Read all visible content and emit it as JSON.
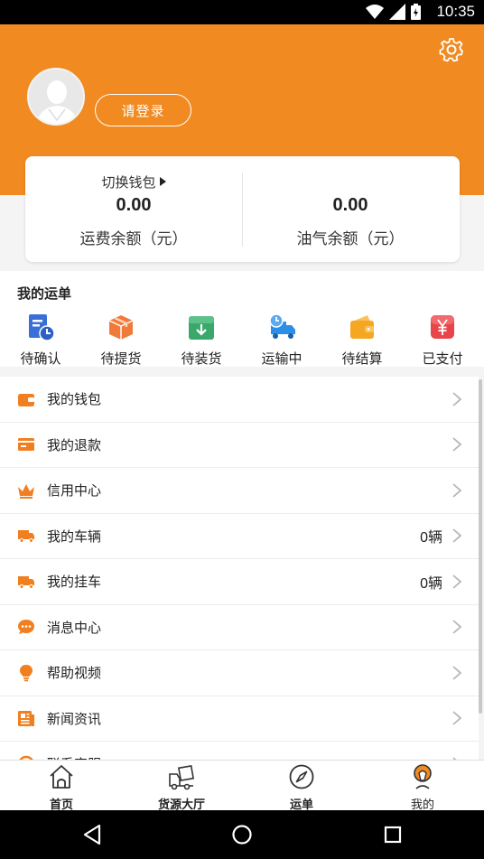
{
  "status_bar": {
    "time": "10:35"
  },
  "header": {
    "login_label": "请登录"
  },
  "wallet": {
    "switch_label": "切换钱包",
    "freight": {
      "amount": "0.00",
      "label": "运费余额（元）"
    },
    "fuel": {
      "amount": "0.00",
      "label": "油气余额（元）"
    }
  },
  "orders": {
    "title": "我的运单",
    "items": [
      {
        "label": "待确认",
        "icon": "clipboard-clock-icon",
        "color": "#3a6fd8"
      },
      {
        "label": "待提货",
        "icon": "box-icon",
        "color": "#f07a3a"
      },
      {
        "label": "待装货",
        "icon": "download-box-icon",
        "color": "#3aa86a"
      },
      {
        "label": "运输中",
        "icon": "truck-clock-icon",
        "color": "#2d8ee8"
      },
      {
        "label": "待结算",
        "icon": "wallet-icon",
        "color": "#f5a623"
      },
      {
        "label": "已支付",
        "icon": "yen-icon",
        "color": "#e8454a"
      }
    ]
  },
  "menu": [
    {
      "label": "我的钱包",
      "icon": "wallet-icon",
      "value": ""
    },
    {
      "label": "我的退款",
      "icon": "refund-icon",
      "value": ""
    },
    {
      "label": "信用中心",
      "icon": "crown-icon",
      "value": ""
    },
    {
      "label": "我的车辆",
      "icon": "truck-icon",
      "value": "0辆"
    },
    {
      "label": "我的挂车",
      "icon": "trailer-icon",
      "value": "0辆"
    },
    {
      "label": "消息中心",
      "icon": "chat-icon",
      "value": ""
    },
    {
      "label": "帮助视频",
      "icon": "bulb-icon",
      "value": ""
    },
    {
      "label": "新闻资讯",
      "icon": "news-icon",
      "value": ""
    },
    {
      "label": "联系客服",
      "icon": "service-icon",
      "value": ""
    }
  ],
  "tabs": [
    {
      "label": "首页",
      "icon": "home-icon"
    },
    {
      "label": "货源大厅",
      "icon": "cargo-truck-icon"
    },
    {
      "label": "运单",
      "icon": "compass-icon"
    },
    {
      "label": "我的",
      "icon": "profile-icon"
    }
  ],
  "colors": {
    "accent": "#f18a20",
    "icon_orange": "#f17f1f"
  }
}
